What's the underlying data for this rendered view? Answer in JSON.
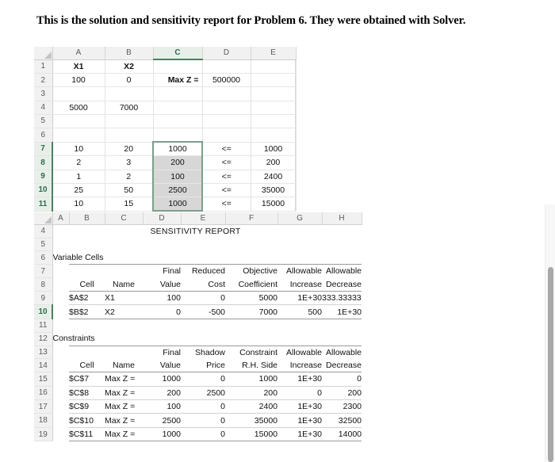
{
  "heading": "This is the solution and sensitivity report for Problem 6. They were obtained with Solver.",
  "colors": {
    "selection_border": "#7d9e8b",
    "header_blue": "#2a2a8c",
    "selected_header": "#2f6b4f",
    "selected_fill": "#d7d7d7"
  },
  "sheet1": {
    "name": "solution-sheet",
    "columns": [
      "A",
      "B",
      "C",
      "D",
      "E"
    ],
    "selected_column": "C",
    "rows": [
      "1",
      "2",
      "3",
      "4",
      "5",
      "6",
      "7",
      "8",
      "9",
      "10",
      "11"
    ],
    "selected_rows": [
      "7",
      "8",
      "9",
      "10",
      "11"
    ],
    "selected_range": "C7:C11",
    "active_cell": "C7",
    "cells": [
      {
        "row": "1",
        "A": "X1",
        "B": "X2",
        "C": "",
        "D": "",
        "E": ""
      },
      {
        "row": "2",
        "A": "100",
        "B": "0",
        "C": "Max Z =",
        "D": "500000",
        "E": ""
      },
      {
        "row": "3",
        "A": "",
        "B": "",
        "C": "",
        "D": "",
        "E": ""
      },
      {
        "row": "4",
        "A": "5000",
        "B": "7000",
        "C": "",
        "D": "",
        "E": ""
      },
      {
        "row": "5",
        "A": "",
        "B": "",
        "C": "",
        "D": "",
        "E": ""
      },
      {
        "row": "6",
        "A": "",
        "B": "",
        "C": "",
        "D": "",
        "E": ""
      },
      {
        "row": "7",
        "A": "10",
        "B": "20",
        "C": "1000",
        "D": "<=",
        "E": "1000"
      },
      {
        "row": "8",
        "A": "2",
        "B": "3",
        "C": "200",
        "D": "<=",
        "E": "200"
      },
      {
        "row": "9",
        "A": "1",
        "B": "2",
        "C": "100",
        "D": "<=",
        "E": "2400"
      },
      {
        "row": "10",
        "A": "25",
        "B": "50",
        "C": "2500",
        "D": "<=",
        "E": "35000"
      },
      {
        "row": "11",
        "A": "10",
        "B": "15",
        "C": "1000",
        "D": "<=",
        "E": "15000"
      }
    ]
  },
  "sheet2": {
    "name": "sensitivity-report-sheet",
    "columns": [
      "A",
      "B",
      "C",
      "D",
      "E",
      "F",
      "G",
      "H"
    ],
    "rows": [
      "4",
      "5",
      "6",
      "7",
      "8",
      "9",
      "10",
      "11",
      "12",
      "13",
      "14",
      "15",
      "16",
      "17",
      "18",
      "19"
    ],
    "selected_rows": [
      "10"
    ],
    "title": "SENSITIVITY REPORT",
    "variable_cells": {
      "section_label": "Variable Cells",
      "header_line1": [
        "",
        "",
        "Final",
        "Reduced",
        "Objective",
        "Allowable",
        "Allowable"
      ],
      "header_line2": [
        "Cell",
        "Name",
        "Value",
        "Cost",
        "Coefficient",
        "Increase",
        "Decrease"
      ],
      "rows": [
        {
          "row": "9",
          "cell": "$A$2",
          "name": "X1",
          "final_value": "100",
          "reduced_cost": "0",
          "objective_coefficient": "5000",
          "allowable_increase": "1E+30",
          "allowable_decrease": "333.3333333"
        },
        {
          "row": "10",
          "cell": "$B$2",
          "name": "X2",
          "final_value": "0",
          "reduced_cost": "-500",
          "objective_coefficient": "7000",
          "allowable_increase": "500",
          "allowable_decrease": "1E+30"
        }
      ]
    },
    "constraints": {
      "section_label": "Constraints",
      "header_line1": [
        "",
        "",
        "Final",
        "Shadow",
        "Constraint",
        "Allowable",
        "Allowable"
      ],
      "header_line2": [
        "Cell",
        "Name",
        "Value",
        "Price",
        "R.H. Side",
        "Increase",
        "Decrease"
      ],
      "rows": [
        {
          "row": "15",
          "cell": "$C$7",
          "name": "Max Z =",
          "final_value": "1000",
          "shadow_price": "0",
          "rh_side": "1000",
          "allowable_increase": "1E+30",
          "allowable_decrease": "0"
        },
        {
          "row": "16",
          "cell": "$C$8",
          "name": "Max Z =",
          "final_value": "200",
          "shadow_price": "2500",
          "rh_side": "200",
          "allowable_increase": "0",
          "allowable_decrease": "200"
        },
        {
          "row": "17",
          "cell": "$C$9",
          "name": "Max Z =",
          "final_value": "100",
          "shadow_price": "0",
          "rh_side": "2400",
          "allowable_increase": "1E+30",
          "allowable_decrease": "2300"
        },
        {
          "row": "18",
          "cell": "$C$10",
          "name": "Max Z =",
          "final_value": "2500",
          "shadow_price": "0",
          "rh_side": "35000",
          "allowable_increase": "1E+30",
          "allowable_decrease": "32500"
        },
        {
          "row": "19",
          "cell": "$C$11",
          "name": "Max Z =",
          "final_value": "1000",
          "shadow_price": "0",
          "rh_side": "15000",
          "allowable_increase": "1E+30",
          "allowable_decrease": "14000"
        }
      ]
    }
  },
  "scrollbar": {
    "name": "vertical-scrollbar"
  }
}
